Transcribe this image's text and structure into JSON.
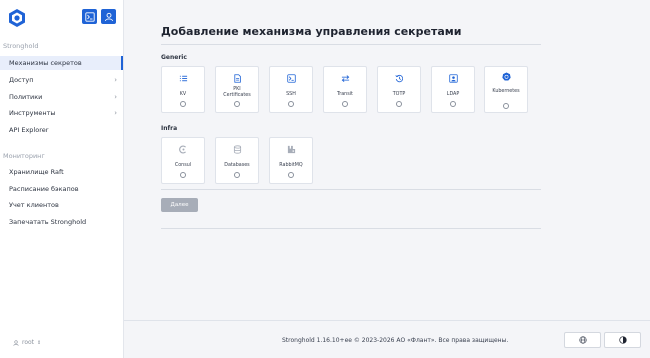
{
  "sidebar": {
    "section1": "Stronghold",
    "items1": [
      {
        "label": "Механизмы секретов",
        "active": true,
        "chevron": false
      },
      {
        "label": "Доступ",
        "active": false,
        "chevron": true
      },
      {
        "label": "Политики",
        "active": false,
        "chevron": true
      },
      {
        "label": "Инструменты",
        "active": false,
        "chevron": true
      },
      {
        "label": "API Explorer",
        "active": false,
        "chevron": false
      }
    ],
    "section2": "Мониторинг",
    "items2": [
      {
        "label": "Хранилище Raft"
      },
      {
        "label": "Расписание бэкапов"
      },
      {
        "label": "Учет клиентов"
      },
      {
        "label": "Запечатать Stronghold"
      }
    ],
    "user": "root"
  },
  "main": {
    "title": "Добавление механизма управления секретами",
    "groups": [
      {
        "label": "Generic",
        "engines": [
          {
            "label": "KV",
            "icon": "list-icon"
          },
          {
            "label": "PKI Certificates",
            "icon": "document-icon"
          },
          {
            "label": "SSH",
            "icon": "terminal-icon"
          },
          {
            "label": "Transit",
            "icon": "arrows-swap-icon"
          },
          {
            "label": "TOTP",
            "icon": "history-icon"
          },
          {
            "label": "LDAP",
            "icon": "user-card-icon"
          },
          {
            "label": "Kubernetes",
            "icon": "kubernetes-icon"
          }
        ]
      },
      {
        "label": "Infra",
        "engines": [
          {
            "label": "Consul",
            "icon": "consul-icon"
          },
          {
            "label": "Databases",
            "icon": "database-icon"
          },
          {
            "label": "RabbitMQ",
            "icon": "rabbitmq-icon"
          }
        ]
      }
    ],
    "next_label": "Далее"
  },
  "footer": {
    "text": "Stronghold 1.16.10+ee   © 2023-2026 АО «Флант». Все права защищены."
  },
  "colors": {
    "accent": "#1f63d6",
    "background": "#f4f5f8",
    "disabled_button": "#a7adb8"
  }
}
